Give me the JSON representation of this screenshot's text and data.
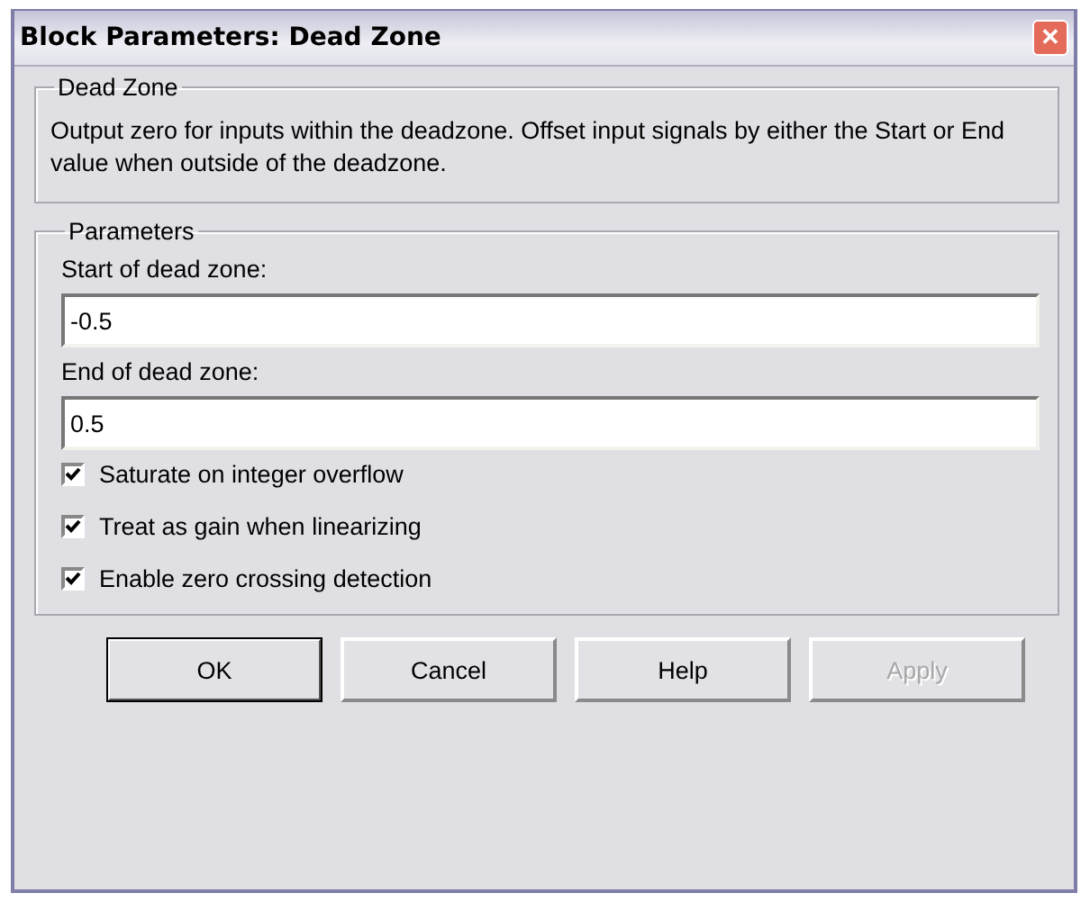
{
  "window": {
    "title": "Block Parameters: Dead Zone",
    "close": "✕"
  },
  "description_group": {
    "title": "Dead Zone",
    "text": "Output zero for inputs within the deadzone.  Offset input signals by either the Start or End value when outside of the deadzone."
  },
  "parameters_group": {
    "title": "Parameters",
    "fields": [
      {
        "label": "Start of dead zone:",
        "value": "-0.5"
      },
      {
        "label": "End of dead zone:",
        "value": "0.5"
      }
    ],
    "checkboxes": [
      {
        "label": "Saturate on integer overflow",
        "checked": true
      },
      {
        "label": "Treat as gain when linearizing",
        "checked": true
      },
      {
        "label": "Enable zero crossing detection",
        "checked": true
      }
    ]
  },
  "buttons": [
    {
      "label": "OK",
      "default": true,
      "disabled": false
    },
    {
      "label": "Cancel",
      "default": false,
      "disabled": false
    },
    {
      "label": "Help",
      "default": false,
      "disabled": false
    },
    {
      "label": "Apply",
      "default": false,
      "disabled": true
    }
  ]
}
